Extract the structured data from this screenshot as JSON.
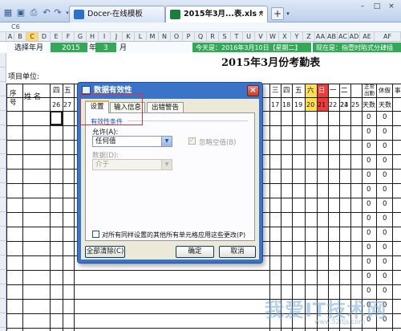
{
  "window": {
    "tabs": [
      {
        "label": "Docer-在线模板",
        "color": "#2e6fc7"
      },
      {
        "label": "2015年3月...表.xls *",
        "color": "#1a7f3c",
        "close": "×"
      }
    ],
    "new_tab": "+",
    "controls": [
      "–",
      "□",
      "×"
    ]
  },
  "formula_bar": {
    "cell_ref": "C6"
  },
  "columns": [
    "A",
    "B",
    "C",
    "D",
    "E",
    "F",
    "G",
    "H",
    "I",
    "J",
    "K",
    "L",
    "M",
    "N",
    "O",
    "P",
    "Q",
    "R",
    "S",
    "T",
    "U",
    "V",
    "W",
    "X",
    "Y",
    "Z",
    "AA",
    "AB",
    "AC",
    "AD",
    "AE",
    "AF"
  ],
  "sheet": {
    "select_label": "选择年月",
    "year": "2015",
    "year_unit": "年",
    "month": "3",
    "month_unit": "月",
    "today": "今天是：2016年3月10日【星期二】",
    "now_is": "现在是：指壹时陷式分肆插",
    "title": "2015年3月份考勤表",
    "project_unit": "项目单位:",
    "hdr_seq": "序号",
    "hdr_name": "姓 名",
    "weekdays_left": [
      "四",
      "五"
    ],
    "days_left": [
      "26",
      "27"
    ],
    "weekdays_right": [
      "三",
      "四",
      "五",
      "六",
      "日",
      "一",
      "二"
    ],
    "days_right": [
      "17",
      "18",
      "19",
      "20",
      "21",
      "22",
      "23"
    ],
    "days_tail": [
      "24",
      "25"
    ],
    "hdr_normal": "正常出勤",
    "hdr_days": "天数",
    "hdr_leave": "休假",
    "hdr_days2": "天数",
    "hdr_affair": "事",
    "zero": "0"
  },
  "colors": {
    "green": "#33a957",
    "sat": "#ffe14d",
    "sun": "#ef3b3b",
    "accent": "#3a74c9"
  },
  "dialog": {
    "title": "数据有效性",
    "tabs": [
      "设置",
      "输入信息",
      "出错警告"
    ],
    "group": "有效性条件",
    "allow_label": "允许(A):",
    "allow_value": "任何值",
    "ignore_blank": "忽略空值(B)",
    "data_label": "数据(D):",
    "data_value": "介于",
    "apply_all": "对所有同样设置的其他所有单元格应用这些更改(P)",
    "clear_all": "全部清除(C)",
    "ok": "确定",
    "cancel": "取消"
  },
  "watermark": {
    "text": "我爱IT技术网",
    "url": "www.52itjs.com"
  }
}
